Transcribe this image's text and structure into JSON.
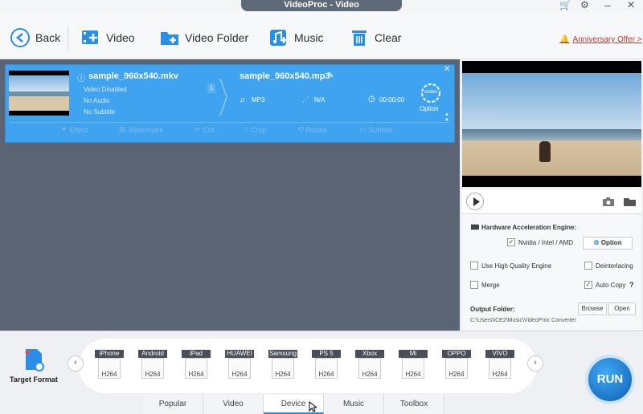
{
  "window": {
    "title": "VideoProc - Video"
  },
  "toolbar": {
    "back": "Back",
    "video": "Video",
    "video_folder": "Video Folder",
    "music": "Music",
    "clear": "Clear",
    "offer": "Anniversary Offer >"
  },
  "item": {
    "source_name": "sample_960x540.mkv",
    "video_status": "Video Disabled",
    "audio_status": "No Audio",
    "subtitle_status": "No Subtitle",
    "badge": "1",
    "output_name": "sample_960x540.mp3",
    "format": "MP3",
    "resolution": "N/A",
    "duration": "00:00:00",
    "codec_label": "codec",
    "option_label": "Option",
    "tools": [
      "Effect",
      "Watermark",
      "Cut",
      "Crop",
      "Rotate",
      "Subtitle"
    ]
  },
  "settings": {
    "hw_title": "Hardware Acceleration Engine:",
    "hw_vendor": "Nvidia / Intel / AMD",
    "option_btn": "Option",
    "high_quality": "Use High Quality Engine",
    "deinterlacing": "Deinterlacing",
    "merge": "Merge",
    "auto_copy": "Auto Copy",
    "output_folder_label": "Output Folder:",
    "browse": "Browse",
    "open": "Open",
    "output_path": "C:\\Users\\ICE2\\Music\\VideoProc Converter"
  },
  "target": {
    "label": "Target Format"
  },
  "formats": [
    {
      "name": "iPhone",
      "codec": "H264"
    },
    {
      "name": "Android",
      "codec": "H264"
    },
    {
      "name": "iPad",
      "codec": "H264"
    },
    {
      "name": "HUAWEI",
      "codec": "H264"
    },
    {
      "name": "Samsung",
      "codec": "H264"
    },
    {
      "name": "PS 5",
      "codec": "H264"
    },
    {
      "name": "Xbox",
      "codec": "H264"
    },
    {
      "name": "Mi",
      "codec": "H264"
    },
    {
      "name": "OPPO",
      "codec": "H264"
    },
    {
      "name": "VIVO",
      "codec": "H264"
    }
  ],
  "tabs": [
    "Popular",
    "Video",
    "Device",
    "Music",
    "Toolbox"
  ],
  "run": "RUN"
}
